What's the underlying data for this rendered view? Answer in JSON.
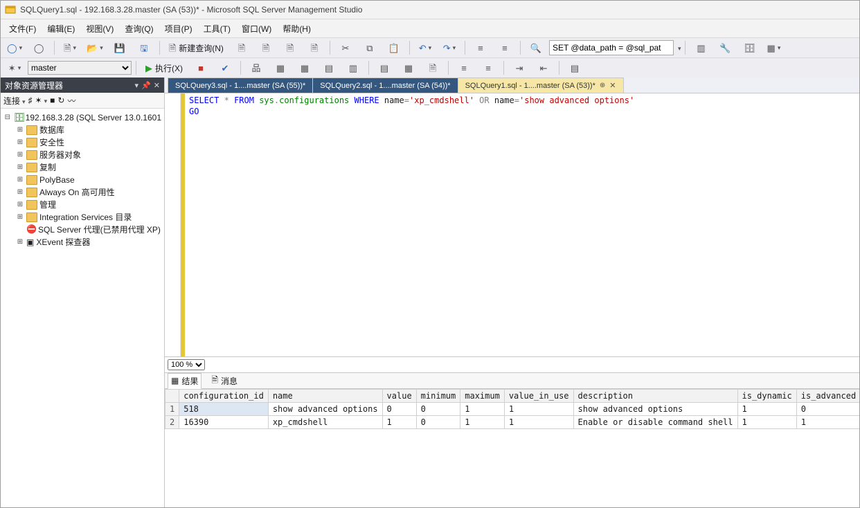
{
  "title": "SQLQuery1.sql - 192.168.3.28.master (SA (53))* - Microsoft SQL Server Management Studio",
  "menu": [
    "文件(F)",
    "编辑(E)",
    "视图(V)",
    "查询(Q)",
    "项目(P)",
    "工具(T)",
    "窗口(W)",
    "帮助(H)"
  ],
  "toolbar1": {
    "new_query": "新建查询(N)",
    "sql_path": "SET @data_path = @sql_pat"
  },
  "toolbar2": {
    "db_selected": "master",
    "db_options": [
      "master"
    ],
    "execute": "执行(X)"
  },
  "panel": {
    "title": "对象资源管理器",
    "connect": "连接"
  },
  "tree": {
    "server": "192.168.3.28 (SQL Server 13.0.1601",
    "nodes": [
      {
        "label": "数据库"
      },
      {
        "label": "安全性"
      },
      {
        "label": "服务器对象"
      },
      {
        "label": "复制"
      },
      {
        "label": "PolyBase"
      },
      {
        "label": "Always On 高可用性"
      },
      {
        "label": "管理"
      },
      {
        "label": "Integration Services 目录"
      }
    ],
    "agent": "SQL Server 代理(已禁用代理 XP)",
    "xevent": "XEvent 探查器"
  },
  "tabs": [
    {
      "label": "SQLQuery3.sql - 1....master (SA (55))*"
    },
    {
      "label": "SQLQuery2.sql - 1....master (SA (54))*"
    },
    {
      "label": "SQLQuery1.sql - 1....master (SA (53))*",
      "active": true
    }
  ],
  "sql": {
    "kw_select": "SELECT",
    "star": "*",
    "kw_from": "FROM",
    "schema": "sys",
    "dot": ".",
    "obj": "configurations",
    "kw_where": "WHERE",
    "col": "name",
    "eq": "=",
    "str1": "'xp_cmdshell'",
    "kw_or": "OR",
    "str2": "'show advanced options'",
    "go": "GO"
  },
  "zoom": "100 %",
  "results_tabs": {
    "results": "结果",
    "messages": "消息"
  },
  "grid": {
    "columns": [
      "configuration_id",
      "name",
      "value",
      "minimum",
      "maximum",
      "value_in_use",
      "description",
      "is_dynamic",
      "is_advanced"
    ],
    "rows": [
      {
        "n": "1",
        "cells": [
          "518",
          "show advanced options",
          "0",
          "0",
          "1",
          "1",
          "show advanced options",
          "1",
          "0"
        ]
      },
      {
        "n": "2",
        "cells": [
          "16390",
          "xp_cmdshell",
          "1",
          "0",
          "1",
          "1",
          "Enable or disable command shell",
          "1",
          "1"
        ]
      }
    ]
  }
}
